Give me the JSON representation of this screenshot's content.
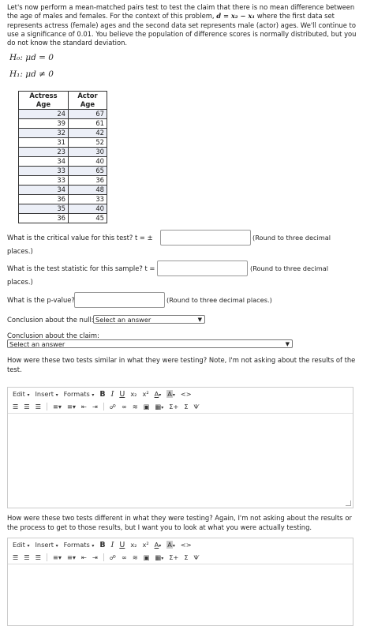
{
  "intro": {
    "part1": "Let's now perform a mean-matched pairs test to test the claim that there is no mean difference between the age of males and females. For the context of this problem, ",
    "formula": "d = x₂ − x₁",
    "part2": " where the first data set represents actress (female) ages and the second data set represents male (actor) ages. We'll continue to use a significance of 0.01. You believe the population of difference scores is normally distributed, but you do not know the standard deviation."
  },
  "hypotheses": {
    "h0_label": "H₀",
    "h0_rest": ": μd = 0",
    "h1_label": "H₁",
    "h1_rest": ": μd ≠ 0"
  },
  "table": {
    "headers": [
      "Actress Age",
      "Actor Age"
    ],
    "rows": [
      [
        "24",
        "67"
      ],
      [
        "39",
        "61"
      ],
      [
        "32",
        "42"
      ],
      [
        "31",
        "52"
      ],
      [
        "23",
        "30"
      ],
      [
        "34",
        "40"
      ],
      [
        "33",
        "65"
      ],
      [
        "33",
        "36"
      ],
      [
        "34",
        "48"
      ],
      [
        "36",
        "33"
      ],
      [
        "35",
        "40"
      ],
      [
        "36",
        "45"
      ]
    ]
  },
  "questions": {
    "critical_label": "What is the critical value for this test? t = ±",
    "critical_hint": "(Round to three decimal",
    "critical_cont": "places.)",
    "stat_label": "What is the test statistic for this sample? t =",
    "stat_hint": "(Round to three decimal",
    "stat_cont": "places.)",
    "p_label": "What is the p-value?",
    "p_hint": "(Round to three decimal places.)",
    "null_label": "Conclusion about the null:",
    "null_select": "Select an answer",
    "claim_label": "Conclusion about the claim:",
    "claim_select": "Select an answer",
    "similar_q": "How were these two tests similar in what they were testing? Note, I'm not asking about the results of the test.",
    "different_q": "How were these two tests different in what they were testing? Again, I'm not asking about the results or the process to get to those results, but I want you to look at what you were actually testing."
  },
  "editor": {
    "edit": "Edit",
    "insert": "Insert",
    "formats": "Formats",
    "caret": "▾",
    "bold": "B",
    "italic": "I",
    "underline": "U",
    "subscript": "x₂",
    "superscript": "x²",
    "font_color": "A",
    "bg_color": "A",
    "code": "<>",
    "table_icon": "▦",
    "sum_plus": "Σ+",
    "sum": "Σ",
    "special": "Ѱ"
  }
}
